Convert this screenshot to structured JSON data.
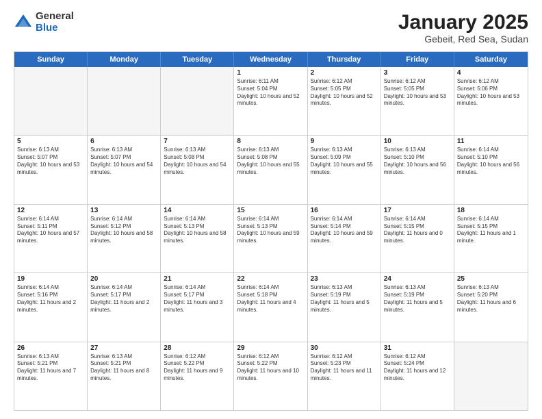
{
  "header": {
    "logo": {
      "line1": "General",
      "line2": "Blue"
    },
    "title": "January 2025",
    "subtitle": "Gebeit, Red Sea, Sudan"
  },
  "weekdays": [
    "Sunday",
    "Monday",
    "Tuesday",
    "Wednesday",
    "Thursday",
    "Friday",
    "Saturday"
  ],
  "rows": [
    [
      {
        "day": "",
        "text": "",
        "empty": true
      },
      {
        "day": "",
        "text": "",
        "empty": true
      },
      {
        "day": "",
        "text": "",
        "empty": true
      },
      {
        "day": "1",
        "text": "Sunrise: 6:11 AM\nSunset: 5:04 PM\nDaylight: 10 hours and 52 minutes."
      },
      {
        "day": "2",
        "text": "Sunrise: 6:12 AM\nSunset: 5:05 PM\nDaylight: 10 hours and 52 minutes."
      },
      {
        "day": "3",
        "text": "Sunrise: 6:12 AM\nSunset: 5:05 PM\nDaylight: 10 hours and 53 minutes."
      },
      {
        "day": "4",
        "text": "Sunrise: 6:12 AM\nSunset: 5:06 PM\nDaylight: 10 hours and 53 minutes."
      }
    ],
    [
      {
        "day": "5",
        "text": "Sunrise: 6:13 AM\nSunset: 5:07 PM\nDaylight: 10 hours and 53 minutes."
      },
      {
        "day": "6",
        "text": "Sunrise: 6:13 AM\nSunset: 5:07 PM\nDaylight: 10 hours and 54 minutes."
      },
      {
        "day": "7",
        "text": "Sunrise: 6:13 AM\nSunset: 5:08 PM\nDaylight: 10 hours and 54 minutes."
      },
      {
        "day": "8",
        "text": "Sunrise: 6:13 AM\nSunset: 5:08 PM\nDaylight: 10 hours and 55 minutes."
      },
      {
        "day": "9",
        "text": "Sunrise: 6:13 AM\nSunset: 5:09 PM\nDaylight: 10 hours and 55 minutes."
      },
      {
        "day": "10",
        "text": "Sunrise: 6:13 AM\nSunset: 5:10 PM\nDaylight: 10 hours and 56 minutes."
      },
      {
        "day": "11",
        "text": "Sunrise: 6:14 AM\nSunset: 5:10 PM\nDaylight: 10 hours and 56 minutes."
      }
    ],
    [
      {
        "day": "12",
        "text": "Sunrise: 6:14 AM\nSunset: 5:11 PM\nDaylight: 10 hours and 57 minutes."
      },
      {
        "day": "13",
        "text": "Sunrise: 6:14 AM\nSunset: 5:12 PM\nDaylight: 10 hours and 58 minutes."
      },
      {
        "day": "14",
        "text": "Sunrise: 6:14 AM\nSunset: 5:13 PM\nDaylight: 10 hours and 58 minutes."
      },
      {
        "day": "15",
        "text": "Sunrise: 6:14 AM\nSunset: 5:13 PM\nDaylight: 10 hours and 59 minutes."
      },
      {
        "day": "16",
        "text": "Sunrise: 6:14 AM\nSunset: 5:14 PM\nDaylight: 10 hours and 59 minutes."
      },
      {
        "day": "17",
        "text": "Sunrise: 6:14 AM\nSunset: 5:15 PM\nDaylight: 11 hours and 0 minutes."
      },
      {
        "day": "18",
        "text": "Sunrise: 6:14 AM\nSunset: 5:15 PM\nDaylight: 11 hours and 1 minute."
      }
    ],
    [
      {
        "day": "19",
        "text": "Sunrise: 6:14 AM\nSunset: 5:16 PM\nDaylight: 11 hours and 2 minutes."
      },
      {
        "day": "20",
        "text": "Sunrise: 6:14 AM\nSunset: 5:17 PM\nDaylight: 11 hours and 2 minutes."
      },
      {
        "day": "21",
        "text": "Sunrise: 6:14 AM\nSunset: 5:17 PM\nDaylight: 11 hours and 3 minutes."
      },
      {
        "day": "22",
        "text": "Sunrise: 6:14 AM\nSunset: 5:18 PM\nDaylight: 11 hours and 4 minutes."
      },
      {
        "day": "23",
        "text": "Sunrise: 6:13 AM\nSunset: 5:19 PM\nDaylight: 11 hours and 5 minutes."
      },
      {
        "day": "24",
        "text": "Sunrise: 6:13 AM\nSunset: 5:19 PM\nDaylight: 11 hours and 5 minutes."
      },
      {
        "day": "25",
        "text": "Sunrise: 6:13 AM\nSunset: 5:20 PM\nDaylight: 11 hours and 6 minutes."
      }
    ],
    [
      {
        "day": "26",
        "text": "Sunrise: 6:13 AM\nSunset: 5:21 PM\nDaylight: 11 hours and 7 minutes."
      },
      {
        "day": "27",
        "text": "Sunrise: 6:13 AM\nSunset: 5:21 PM\nDaylight: 11 hours and 8 minutes."
      },
      {
        "day": "28",
        "text": "Sunrise: 6:12 AM\nSunset: 5:22 PM\nDaylight: 11 hours and 9 minutes."
      },
      {
        "day": "29",
        "text": "Sunrise: 6:12 AM\nSunset: 5:22 PM\nDaylight: 11 hours and 10 minutes."
      },
      {
        "day": "30",
        "text": "Sunrise: 6:12 AM\nSunset: 5:23 PM\nDaylight: 11 hours and 11 minutes."
      },
      {
        "day": "31",
        "text": "Sunrise: 6:12 AM\nSunset: 5:24 PM\nDaylight: 11 hours and 12 minutes."
      },
      {
        "day": "",
        "text": "",
        "empty": true
      }
    ]
  ]
}
